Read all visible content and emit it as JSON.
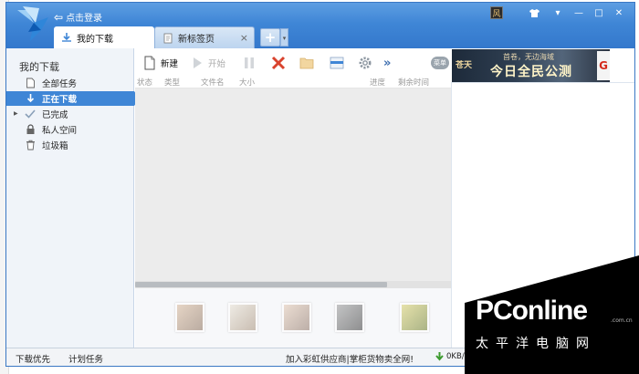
{
  "window": {
    "login_label": "点击登录",
    "tabs": [
      {
        "label": "我的下载"
      },
      {
        "label": "新标签页"
      }
    ],
    "add_tab_label": "+",
    "skin_label": "风",
    "controls": {
      "min": "—",
      "max": "□",
      "close": "✕"
    }
  },
  "sidebar": {
    "title": "我的下载",
    "items": [
      {
        "label": "全部任务",
        "icon": "document-icon"
      },
      {
        "label": "正在下载",
        "icon": "download-arrow-icon",
        "active": true
      },
      {
        "label": "已完成",
        "icon": "check-icon"
      },
      {
        "label": "私人空间",
        "icon": "lock-icon"
      },
      {
        "label": "垃圾箱",
        "icon": "trash-icon"
      }
    ]
  },
  "toolbar": {
    "new_label": "新建",
    "start_label": "开始",
    "more_label": "»",
    "menu_label": "菜单"
  },
  "columns": [
    "状态",
    "类型",
    "文件名",
    "大小",
    "进度",
    "剩余时间"
  ],
  "banner": {
    "brand": "苍天",
    "line1": "首卷，无边海域",
    "line2": "今日全民公测",
    "logo_letter": "G"
  },
  "statusbar": {
    "download_priority": "下载优先",
    "scheduled_tasks": "计划任务",
    "ad_text": "加入彩虹供应商|掌柜货物卖全网!",
    "speed": "0KB/S"
  },
  "watermark": {
    "word": "PConline",
    "domain": ".com.cn",
    "chinese": "太平洋电脑网"
  },
  "colors": {
    "title_blue": "#3f86d6",
    "sidebar_bg": "#f0f4f9",
    "active_item": "#3f86d6"
  }
}
